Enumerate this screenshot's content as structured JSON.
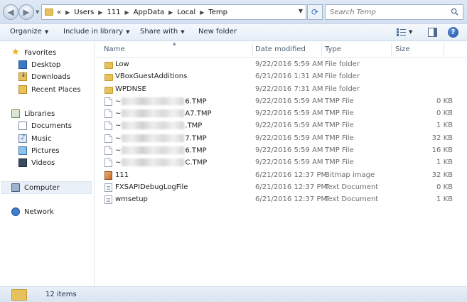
{
  "address_bar": {
    "overflow": "«",
    "path": [
      "Users",
      "111",
      "AppData",
      "Local",
      "Temp"
    ]
  },
  "search": {
    "placeholder": "Search Temp"
  },
  "toolbar": {
    "organize": "Organize",
    "include_in_library": "Include in library",
    "share_with": "Share with",
    "new_folder": "New folder"
  },
  "nav": {
    "favorites": "Favorites",
    "desktop": "Desktop",
    "downloads": "Downloads",
    "recent_places": "Recent Places",
    "libraries": "Libraries",
    "documents": "Documents",
    "music": "Music",
    "pictures": "Pictures",
    "videos": "Videos",
    "computer": "Computer",
    "network": "Network"
  },
  "columns": {
    "name": "Name",
    "date_modified": "Date modified",
    "type": "Type",
    "size": "Size"
  },
  "files": [
    {
      "icon": "folder-icon",
      "name": "Low",
      "date": "9/22/2016 5:59 AM",
      "type": "File folder",
      "size": ""
    },
    {
      "icon": "folder-icon",
      "name": "VBoxGuestAdditions",
      "date": "6/21/2016 1:31 AM",
      "type": "File folder",
      "size": ""
    },
    {
      "icon": "folder-icon",
      "name": "WPDNSE",
      "date": "9/22/2016 7:31 AM",
      "type": "File folder",
      "size": ""
    },
    {
      "icon": "file-icon",
      "name_prefix": "~",
      "name_suffix": "6.TMP",
      "date": "9/22/2016 5:59 AM",
      "type": "TMP File",
      "size": "0 KB"
    },
    {
      "icon": "file-icon",
      "name_prefix": "~",
      "name_suffix": "A7.TMP",
      "date": "9/22/2016 5:59 AM",
      "type": "TMP File",
      "size": "0 KB"
    },
    {
      "icon": "file-icon",
      "name_prefix": "~",
      "name_suffix": ".TMP",
      "date": "9/22/2016 5:59 AM",
      "type": "TMP File",
      "size": "1 KB"
    },
    {
      "icon": "file-icon",
      "name_prefix": "~",
      "name_suffix": "7.TMP",
      "date": "9/22/2016 5:59 AM",
      "type": "TMP File",
      "size": "32 KB"
    },
    {
      "icon": "file-icon",
      "name_prefix": "~",
      "name_suffix": "6.TMP",
      "date": "9/22/2016 5:59 AM",
      "type": "TMP File",
      "size": "16 KB"
    },
    {
      "icon": "file-icon",
      "name_prefix": "~",
      "name_suffix": "C.TMP",
      "date": "9/22/2016 5:59 AM",
      "type": "TMP File",
      "size": "1 KB"
    },
    {
      "icon": "bitmap-icon",
      "name": "111",
      "date": "6/21/2016 12:37 PM",
      "type": "Bitmap image",
      "size": "32 KB"
    },
    {
      "icon": "text-document-icon",
      "name": "FXSAPIDebugLogFile",
      "date": "6/21/2016 12:37 PM",
      "type": "Text Document",
      "size": "0 KB"
    },
    {
      "icon": "text-document-icon",
      "name": "wmsetup",
      "date": "6/21/2016 12:37 PM",
      "type": "Text Document",
      "size": "1 KB"
    }
  ],
  "status": {
    "item_count": "12 items"
  }
}
